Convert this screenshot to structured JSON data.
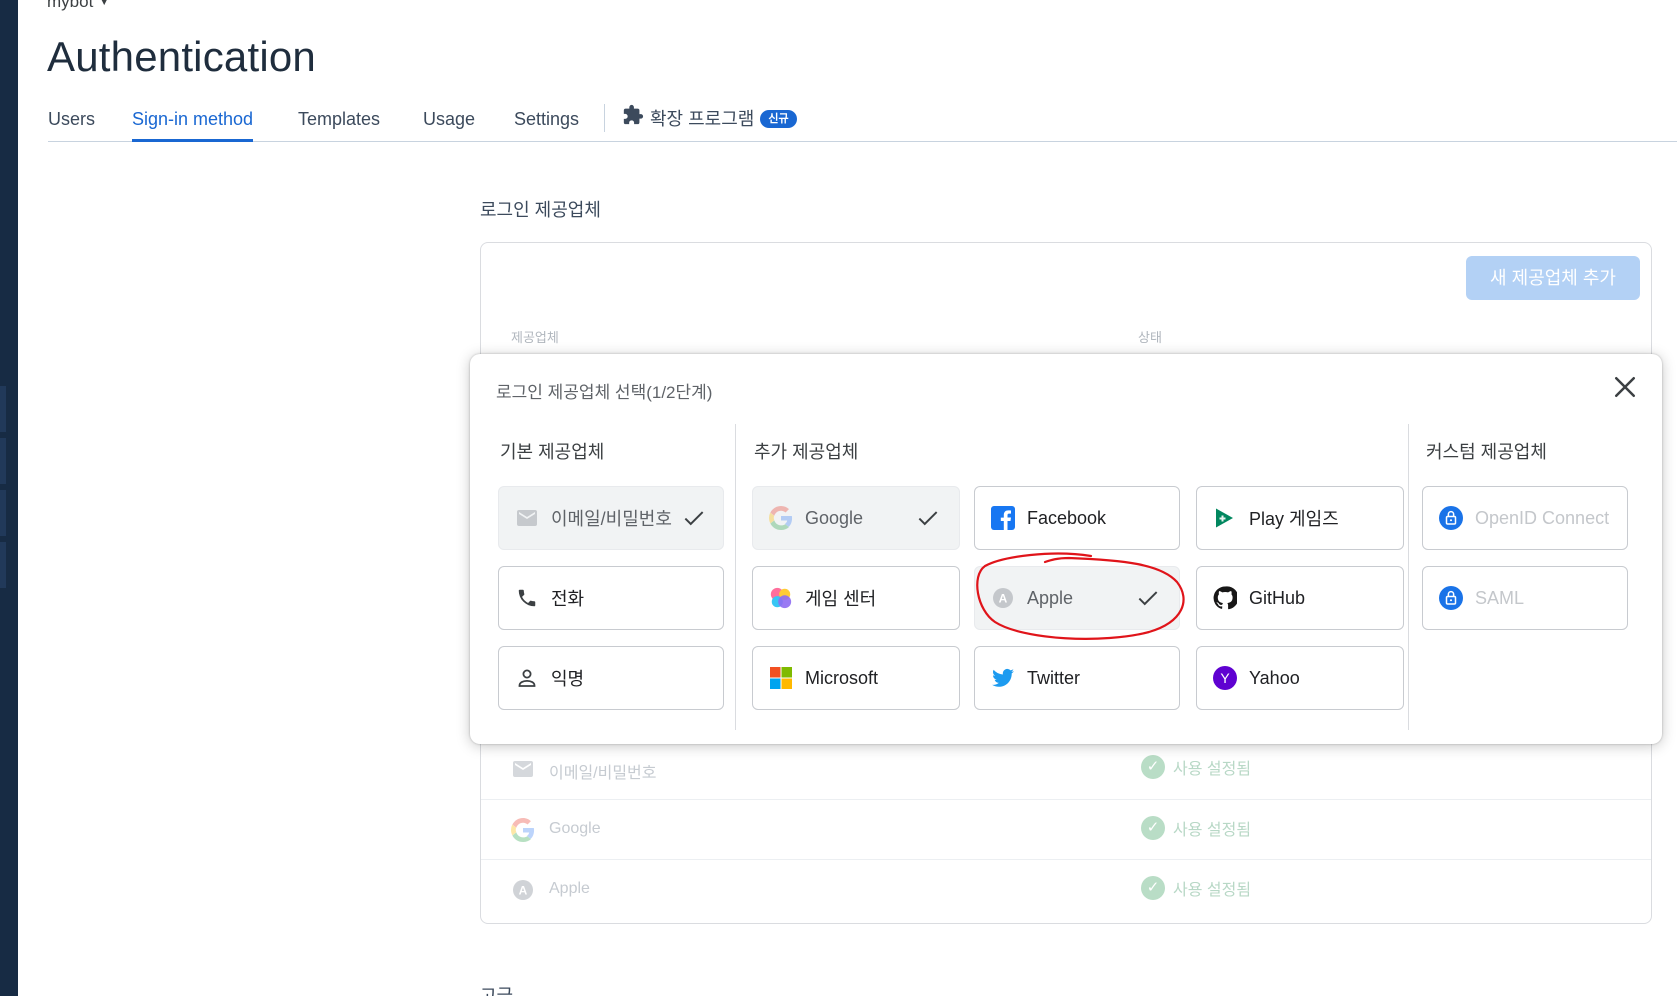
{
  "project": {
    "name": "mybot"
  },
  "page": {
    "title": "Authentication"
  },
  "tabs": [
    {
      "label": "Users"
    },
    {
      "label": "Sign-in method"
    },
    {
      "label": "Templates"
    },
    {
      "label": "Usage"
    },
    {
      "label": "Settings"
    }
  ],
  "extension_tab": {
    "label": "확장 프로그램",
    "badge": "신규"
  },
  "section": {
    "label": "로그인 제공업체",
    "footer_label": "고급"
  },
  "providers_table": {
    "add_button": "새 제공업체 추가",
    "col_provider": "제공업체",
    "col_status": "상태",
    "rows": [
      {
        "name": "이메일/비밀번호",
        "status": "사용 설정됨",
        "icon": "mail-icon"
      },
      {
        "name": "Google",
        "status": "사용 설정됨",
        "icon": "google-icon"
      },
      {
        "name": "Apple",
        "status": "사용 설정됨",
        "icon": "apple-icon"
      }
    ]
  },
  "dialog": {
    "title": "로그인 제공업체 선택(1/2단계)",
    "basic": {
      "title": "기본 제공업체",
      "items": [
        {
          "label": "이메일/비밀번호",
          "enabled": true,
          "icon": "mail-icon"
        },
        {
          "label": "전화",
          "enabled": false,
          "icon": "phone-icon"
        },
        {
          "label": "익명",
          "enabled": false,
          "icon": "person-icon"
        }
      ]
    },
    "additional": {
      "title": "추가 제공업체",
      "items": [
        {
          "label": "Google",
          "enabled": true,
          "icon": "google-icon"
        },
        {
          "label": "Facebook",
          "enabled": false,
          "icon": "facebook-icon"
        },
        {
          "label": "Play 게임즈",
          "enabled": false,
          "icon": "play-games-icon"
        },
        {
          "label": "게임 센터",
          "enabled": false,
          "icon": "game-center-icon"
        },
        {
          "label": "Apple",
          "enabled": true,
          "icon": "apple-icon",
          "annotated": true
        },
        {
          "label": "GitHub",
          "enabled": false,
          "icon": "github-icon"
        },
        {
          "label": "Microsoft",
          "enabled": false,
          "icon": "microsoft-icon"
        },
        {
          "label": "Twitter",
          "enabled": false,
          "icon": "twitter-icon"
        },
        {
          "label": "Yahoo",
          "enabled": false,
          "icon": "yahoo-icon"
        }
      ]
    },
    "custom": {
      "title": "커스텀 제공업체",
      "items": [
        {
          "label": "OpenID Connect",
          "disabled": true,
          "icon": "lock-icon"
        },
        {
          "label": "SAML",
          "disabled": true,
          "icon": "lock-icon"
        }
      ]
    }
  },
  "colors": {
    "accent": "#1967d2",
    "annotation": "#e0141a",
    "nav_bg": "#172b44",
    "enabled_status": "#b9ddc6"
  }
}
